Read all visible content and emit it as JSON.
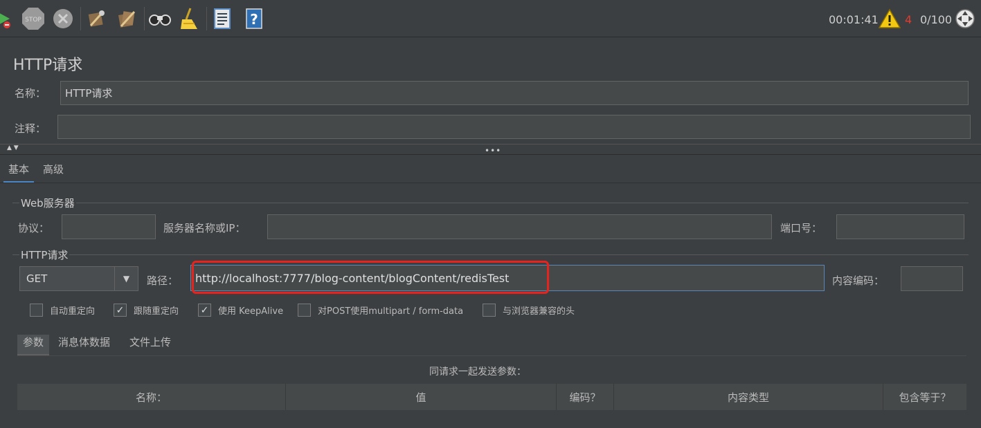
{
  "toolbar": {
    "icons": [
      "run-no-pause-icon",
      "stop-icon",
      "shutdown-icon",
      "clear-icon",
      "clear-all-icon",
      "search-icon",
      "reset-search-icon",
      "function-helper-icon",
      "help-icon"
    ],
    "stop_label": "STOP",
    "elapsed_time": "00:01:41",
    "warning_count": "4",
    "threads": "0/100"
  },
  "header": {
    "title": "HTTP请求",
    "name_label": "名称：",
    "name_value": "HTTP请求",
    "comment_label": "注释：",
    "comment_value": ""
  },
  "splitter": {
    "dots": "•••",
    "arrows": "▲ ▼"
  },
  "tabs": [
    {
      "label": "基本",
      "active": true
    },
    {
      "label": "高级",
      "active": false
    }
  ],
  "web_server": {
    "section_title": "Web服务器",
    "protocol_label": "协议：",
    "protocol_value": "",
    "server_label": "服务器名称或IP：",
    "server_value": "",
    "port_label": "端口号：",
    "port_value": ""
  },
  "http_request": {
    "section_title": "HTTP请求",
    "method": "GET",
    "path_label": "路径：",
    "path_value": "http://localhost:7777/blog-content/blogContent/redisTest",
    "encoding_label": "内容编码：",
    "encoding_value": ""
  },
  "checkboxes": [
    {
      "label": "自动重定向",
      "checked": false
    },
    {
      "label": "跟随重定向",
      "checked": true
    },
    {
      "label": "使用 KeepAlive",
      "checked": true
    },
    {
      "label": "对POST使用multipart / form-data",
      "checked": false
    },
    {
      "label": "与浏览器兼容的头",
      "checked": false
    }
  ],
  "subtabs": [
    {
      "label": "参数",
      "active": true
    },
    {
      "label": "消息体数据",
      "active": false
    },
    {
      "label": "文件上传",
      "active": false
    }
  ],
  "params_table": {
    "caption": "同请求一起发送参数：",
    "columns": [
      "名称：",
      "值",
      "编码？",
      "内容类型",
      "包含等于？"
    ]
  },
  "colors": {
    "background": "#3c3f41",
    "field": "#45494a",
    "focus_border": "#5b86b8",
    "highlight": "#e8231e",
    "warning": "#f2c811",
    "warning_count": "#e03c31"
  }
}
